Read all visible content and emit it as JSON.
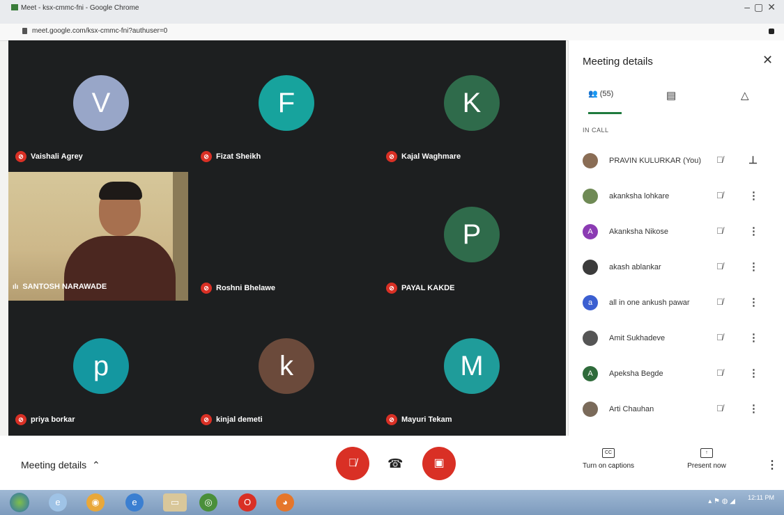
{
  "browser": {
    "title": "Meet - ksx-cmmc-fni - Google Chrome",
    "url": "meet.google.com/ksx-cmmc-fni?authuser=0"
  },
  "grid": {
    "tiles": [
      {
        "initial": "V",
        "name": "Vaishali Agrey",
        "color": "#98a6c8"
      },
      {
        "initial": "F",
        "name": "Fizat Sheikh",
        "color": "#17a39d"
      },
      {
        "initial": "K",
        "name": "Kajal Waghmare",
        "color": "#2f6b4b"
      },
      {
        "initial": "",
        "name": "SANTOSH NARAWADE",
        "color": ""
      },
      {
        "initial": "",
        "name": "Roshni Bhelawe",
        "color": ""
      },
      {
        "initial": "P",
        "name": "PAYAL KAKDE",
        "color": "#2f6b4b"
      },
      {
        "initial": "p",
        "name": "priya borkar",
        "color": "#1497a0"
      },
      {
        "initial": "k",
        "name": "kinjal demeti",
        "color": "#6b4a3b"
      },
      {
        "initial": "M",
        "name": "Mayuri Tekam",
        "color": "#1f9c9a"
      }
    ]
  },
  "panel": {
    "title": "Meeting details",
    "people_tab_count": "(55)",
    "section_label": "IN CALL",
    "people": [
      {
        "name": "PRAVIN KULURKAR (You)",
        "avatar": "",
        "color": "#8a6d55"
      },
      {
        "name": "akanksha lohkare",
        "avatar": "",
        "color": "#6f8a55"
      },
      {
        "name": "Akanksha Nikose",
        "avatar": "A",
        "color": "#8b3bb3"
      },
      {
        "name": "akash ablankar",
        "avatar": "",
        "color": "#3b3b3b"
      },
      {
        "name": "all in one ankush pawar",
        "avatar": "a",
        "color": "#3b5fd1"
      },
      {
        "name": "Amit Sukhadeve",
        "avatar": "",
        "color": "#555555"
      },
      {
        "name": "Apeksha Begde",
        "avatar": "A",
        "color": "#2f6b3b"
      },
      {
        "name": "Arti Chauhan",
        "avatar": "",
        "color": "#7a6a5a"
      }
    ]
  },
  "bottombar": {
    "meeting_details": "Meeting details",
    "captions": "Turn on captions",
    "present": "Present now"
  },
  "taskbar": {
    "time": "12:11 PM"
  }
}
